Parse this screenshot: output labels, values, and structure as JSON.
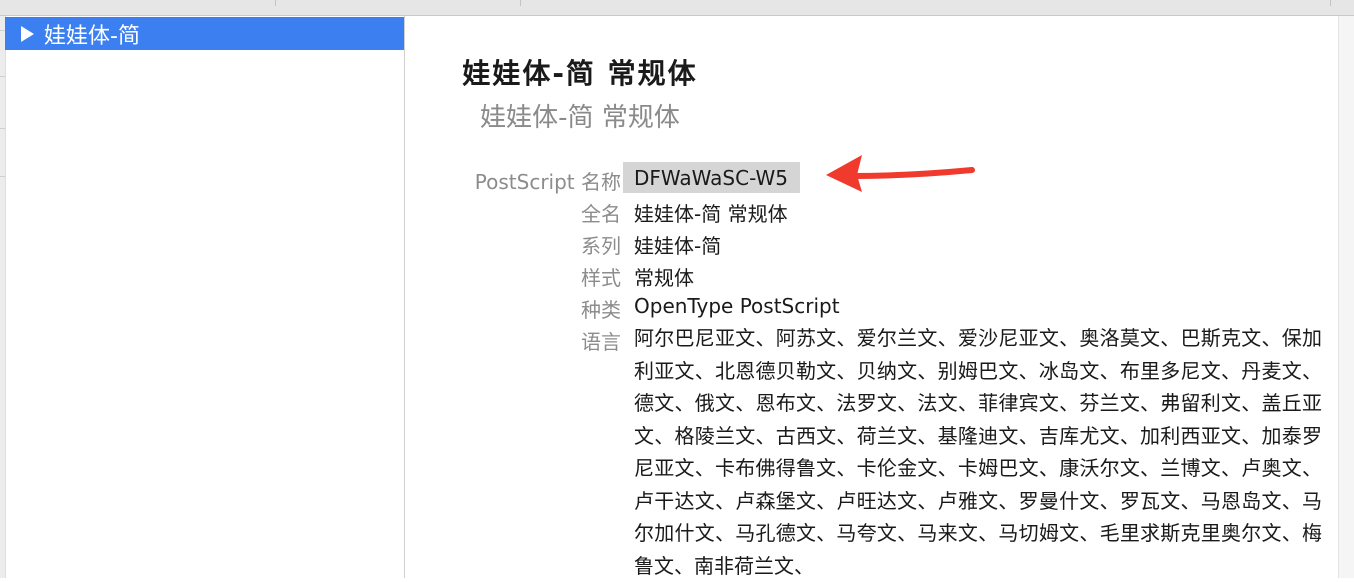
{
  "sidebar": {
    "family_item": "娃娃体-简"
  },
  "preview": {
    "title": "娃娃体-简 常规体",
    "subtitle": "娃娃体-简 常规体"
  },
  "info": {
    "postscript": {
      "label": "PostScript 名称",
      "value": "DFWaWaSC-W5"
    },
    "fullname": {
      "label": "全名",
      "value": "娃娃体-简 常规体"
    },
    "family": {
      "label": "系列",
      "value": "娃娃体-简"
    },
    "style": {
      "label": "样式",
      "value": "常规体"
    },
    "kind": {
      "label": "种类",
      "value": "OpenType PostScript"
    },
    "language": {
      "label": "语言",
      "value": "阿尔巴尼亚文、阿苏文、爱尔兰文、爱沙尼亚文、奥洛莫文、巴斯克文、保加利亚文、北恩德贝勒文、贝纳文、别姆巴文、冰岛文、布里多尼文、丹麦文、德文、俄文、恩布文、法罗文、法文、菲律宾文、芬兰文、弗留利文、盖丘亚文、格陵兰文、古西文、荷兰文、基隆迪文、吉库尤文、加利西亚文、加泰罗尼亚文、卡布佛得鲁文、卡伦金文、卡姆巴文、康沃尔文、兰博文、卢奥文、卢干达文、卢森堡文、卢旺达文、卢雅文、罗曼什文、罗瓦文、马恩岛文、马尔加什文、马孔德文、马夸文、马来文、马切姆文、毛里求斯克里奥尔文、梅鲁文、南非荷兰文、"
    }
  },
  "annotation": {
    "arrow_color": "#f03a2e",
    "icon": "red-arrow-icon"
  },
  "colors": {
    "selection": "#3c7ff0",
    "highlight": "#d5d5d5"
  }
}
